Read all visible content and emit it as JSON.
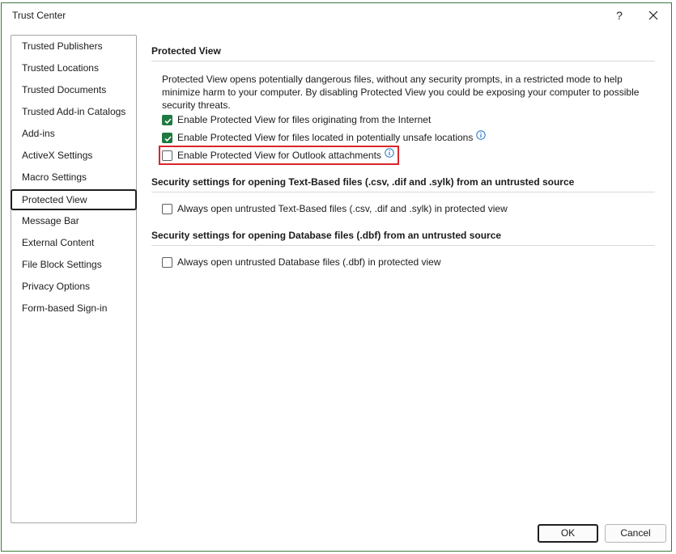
{
  "window": {
    "title": "Trust Center",
    "help_label": "?"
  },
  "sidebar": {
    "items": [
      {
        "label": "Trusted Publishers"
      },
      {
        "label": "Trusted Locations"
      },
      {
        "label": "Trusted Documents"
      },
      {
        "label": "Trusted Add-in Catalogs"
      },
      {
        "label": "Add-ins"
      },
      {
        "label": "ActiveX Settings"
      },
      {
        "label": "Macro Settings"
      },
      {
        "label": "Protected View"
      },
      {
        "label": "Message Bar"
      },
      {
        "label": "External Content"
      },
      {
        "label": "File Block Settings"
      },
      {
        "label": "Privacy Options"
      },
      {
        "label": "Form-based Sign-in"
      }
    ],
    "selected": "Protected View"
  },
  "main": {
    "section1_title": "Protected View",
    "description": "Protected View opens potentially dangerous files, without any security prompts, in a restricted mode to help minimize harm to your computer. By disabling Protected View you could be exposing your computer to possible security threats.",
    "opt_internet": {
      "label": "Enable Protected View for files originating from the Internet",
      "checked": true
    },
    "opt_unsafe": {
      "label": "Enable Protected View for files located in potentially unsafe locations",
      "checked": true
    },
    "opt_outlook": {
      "label": "Enable Protected View for Outlook attachments",
      "checked": false
    },
    "section2_title": "Security settings for opening Text-Based files (.csv, .dif and .sylk) from an untrusted source",
    "opt_text": {
      "label": "Always open untrusted Text-Based files (.csv, .dif and .sylk) in protected view",
      "checked": false
    },
    "section3_title": "Security settings for opening Database files (.dbf) from an untrusted source",
    "opt_db": {
      "label": "Always open untrusted Database files (.dbf) in protected view",
      "checked": false
    }
  },
  "footer": {
    "ok_label": "OK",
    "cancel_label": "Cancel"
  },
  "colors": {
    "checkbox_checked": "#1f7a41",
    "highlight_border": "#d9252a",
    "info_icon": "#1a73c7"
  }
}
